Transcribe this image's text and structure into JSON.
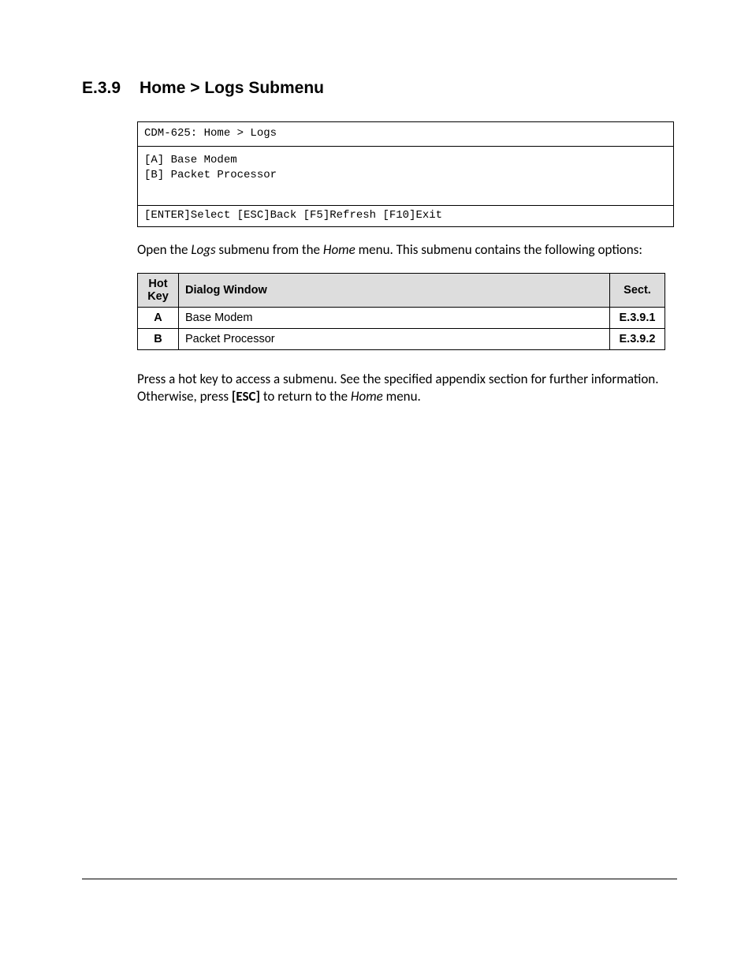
{
  "heading": {
    "number": "E.3.9",
    "title": "Home > Logs Submenu"
  },
  "terminal": {
    "title": "CDM-625: Home > Logs",
    "lines": [
      "[A]  Base Modem",
      "[B]  Packet Processor"
    ],
    "footer": "[ENTER]Select [ESC]Back [F5]Refresh [F10]Exit"
  },
  "para1": {
    "t1": "Open the ",
    "i1": "Logs",
    "t2": " submenu from the ",
    "i2": "Home",
    "t3": " menu. This submenu contains the following options:"
  },
  "table": {
    "headers": {
      "key": "Hot Key",
      "dialog": "Dialog Window",
      "sect": "Sect."
    },
    "rows": [
      {
        "key": "A",
        "dialog": "Base Modem",
        "sect": "E.3.9.1"
      },
      {
        "key": "B",
        "dialog": "Packet Processor",
        "sect": "E.3.9.2"
      }
    ]
  },
  "para2": {
    "t1": "Press a hot key to access a submenu. See the specified appendix section for further information. Otherwise, press ",
    "b1": "[ESC]",
    "t2": " to return to the ",
    "i1": "Home",
    "t3": " menu."
  }
}
